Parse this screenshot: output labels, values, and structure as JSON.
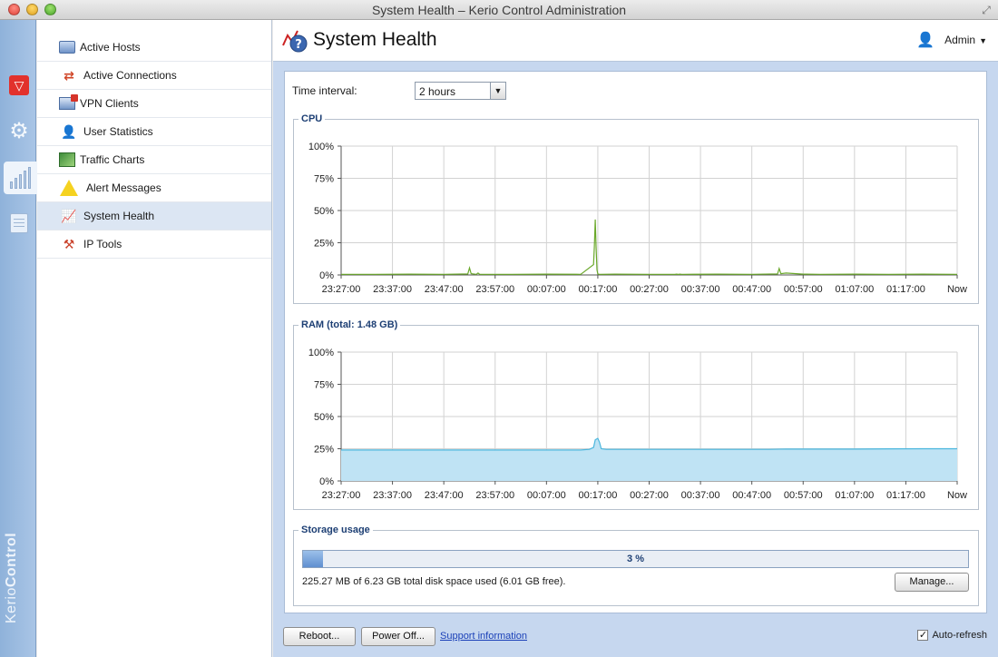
{
  "window": {
    "title": "System Health – Kerio Control Administration"
  },
  "rail": {
    "brand_light": "Kerio",
    "brand_bold": "Control",
    "items": [
      {
        "icon": "shield-icon"
      },
      {
        "icon": "gear-icon"
      },
      {
        "icon": "status-bars-icon"
      },
      {
        "icon": "logs-icon"
      }
    ]
  },
  "sidebar": {
    "items": [
      {
        "label": "Active Hosts",
        "icon": "hosts-icon"
      },
      {
        "label": "Active Connections",
        "icon": "connections-icon"
      },
      {
        "label": "VPN Clients",
        "icon": "vpn-icon"
      },
      {
        "label": "User Statistics",
        "icon": "user-icon"
      },
      {
        "label": "Traffic Charts",
        "icon": "traffic-chart-icon"
      },
      {
        "label": "Alert Messages",
        "icon": "warning-icon"
      },
      {
        "label": "System Health",
        "icon": "health-icon",
        "selected": true
      },
      {
        "label": "IP Tools",
        "icon": "tools-icon"
      }
    ]
  },
  "header": {
    "title": "System Health",
    "user": "Admin"
  },
  "time_interval": {
    "label": "Time interval:",
    "value": "2 hours"
  },
  "chart_data": [
    {
      "type": "line",
      "title": "CPU",
      "y_ticks": [
        "100%",
        "75%",
        "50%",
        "25%",
        "0%"
      ],
      "ylim": [
        0,
        100
      ],
      "x_ticks": [
        "23:27:00",
        "23:37:00",
        "23:47:00",
        "23:57:00",
        "00:07:00",
        "00:17:00",
        "00:27:00",
        "00:37:00",
        "00:47:00",
        "00:57:00",
        "01:07:00",
        "01:17:00",
        "Now"
      ],
      "grid": true,
      "color": "#6aa82a",
      "x": [
        0,
        40,
        80,
        120,
        148,
        150,
        152,
        158,
        160,
        162,
        200,
        240,
        280,
        295,
        296,
        297,
        298,
        299,
        300,
        302,
        320,
        360,
        390,
        392,
        394,
        396,
        398,
        400,
        440,
        480,
        510,
        512,
        514,
        520,
        540,
        560,
        600,
        640,
        680,
        720
      ],
      "values": [
        0.5,
        0.5,
        0.6,
        0.5,
        0.8,
        5.5,
        1,
        0.5,
        1.5,
        0.5,
        0.5,
        0.6,
        0.5,
        8,
        22,
        43,
        22,
        4,
        0.8,
        0.5,
        0.6,
        0.5,
        0.5,
        0.6,
        0.4,
        0.6,
        0.5,
        0.5,
        0.6,
        0.5,
        0.8,
        5,
        1,
        1.5,
        0.6,
        0.5,
        0.6,
        0.5,
        0.6,
        0.5
      ]
    },
    {
      "type": "area",
      "title": "RAM (total: 1.48 GB)",
      "y_ticks": [
        "100%",
        "75%",
        "50%",
        "25%",
        "0%"
      ],
      "ylim": [
        0,
        100
      ],
      "x_ticks": [
        "23:27:00",
        "23:37:00",
        "23:47:00",
        "23:57:00",
        "00:07:00",
        "00:17:00",
        "00:27:00",
        "00:37:00",
        "00:47:00",
        "00:57:00",
        "01:07:00",
        "01:17:00",
        "Now"
      ],
      "grid": true,
      "color": "#4ab6dd",
      "fill": "#bfe3f4",
      "x": [
        0,
        100,
        200,
        280,
        290,
        295,
        297,
        300,
        302,
        304,
        310,
        360,
        400,
        450,
        500,
        520,
        560,
        600,
        640,
        680,
        720
      ],
      "values": [
        24,
        24,
        24,
        24,
        24.5,
        26,
        32,
        33,
        30,
        25,
        24.5,
        24.5,
        24.5,
        24.5,
        24.5,
        24.8,
        24.7,
        24.7,
        24.9,
        25,
        25
      ]
    }
  ],
  "storage": {
    "title": "Storage usage",
    "percent": 3,
    "percent_label": "3 %",
    "text": "225.27 MB of 6.23 GB total disk space used (6.01 GB free).",
    "manage_label": "Manage..."
  },
  "footer": {
    "reboot_label": "Reboot...",
    "power_label": "Power Off...",
    "support_label": "Support information",
    "auto_refresh_label": "Auto-refresh",
    "auto_refresh_checked": true
  }
}
